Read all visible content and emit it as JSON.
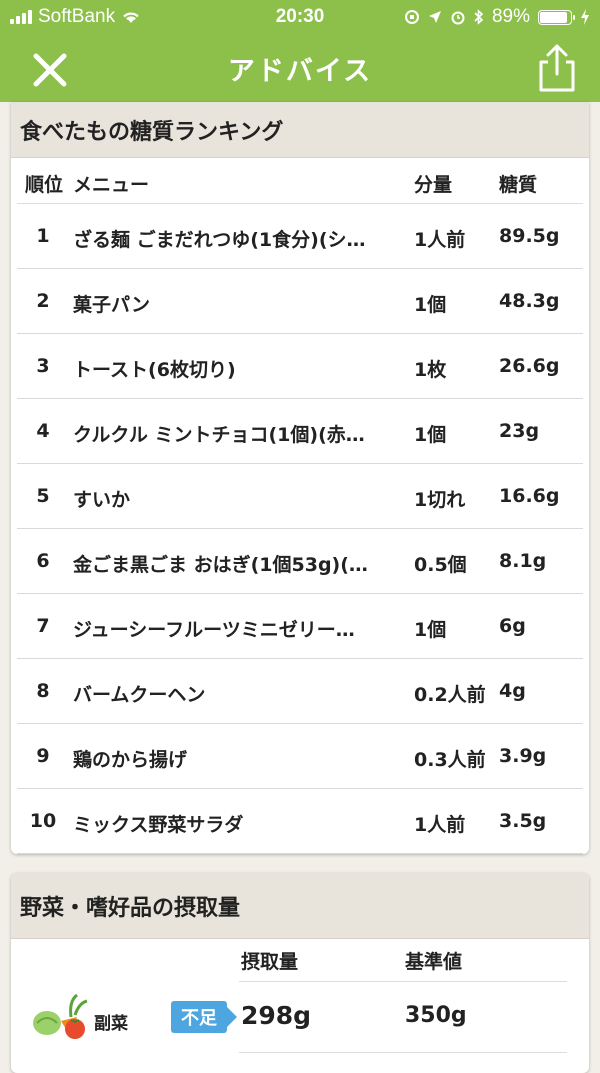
{
  "status_bar": {
    "carrier": "SoftBank",
    "time": "20:30",
    "battery": "89%",
    "battery_level": 0.89
  },
  "header": {
    "title": "アドバイス"
  },
  "ranking": {
    "title": "食べたもの糖質ランキング",
    "columns": {
      "rank": "順位",
      "menu": "メニュー",
      "qty": "分量",
      "carb": "糖質"
    },
    "rows": [
      {
        "rank": "1",
        "menu": "ざる麺 ごまだれつゆ(1食分)(シ…",
        "qty": "1人前",
        "carb": "89.5g"
      },
      {
        "rank": "2",
        "menu": "菓子パン",
        "qty": "1個",
        "carb": "48.3g"
      },
      {
        "rank": "3",
        "menu": "トースト(6枚切り)",
        "qty": "1枚",
        "carb": "26.6g"
      },
      {
        "rank": "4",
        "menu": "クルクル ミントチョコ(1個)(赤…",
        "qty": "1個",
        "carb": "23g"
      },
      {
        "rank": "5",
        "menu": "すいか",
        "qty": "1切れ",
        "carb": "16.6g"
      },
      {
        "rank": "6",
        "menu": "金ごま黒ごま おはぎ(1個53g)(…",
        "qty": "0.5個",
        "carb": "8.1g"
      },
      {
        "rank": "7",
        "menu": "ジューシーフルーツミニゼリー…",
        "qty": "1個",
        "carb": "6g"
      },
      {
        "rank": "8",
        "menu": "バームクーヘン",
        "qty": "0.2人前",
        "carb": "4g"
      },
      {
        "rank": "9",
        "menu": "鶏のから揚げ",
        "qty": "0.3人前",
        "carb": "3.9g"
      },
      {
        "rank": "10",
        "menu": "ミックス野菜サラダ",
        "qty": "1人前",
        "carb": "3.5g"
      }
    ]
  },
  "vegetables": {
    "title": "野菜・嗜好品の摂取量",
    "columns": {
      "intake": "摂取量",
      "standard": "基準値"
    },
    "rows": [
      {
        "label": "副菜",
        "status": "不足",
        "intake": "298g",
        "standard": "350g"
      }
    ]
  },
  "colors": {
    "accent": "#8cc04b",
    "card_header": "#e9e4db",
    "badge": "#4da6e0"
  }
}
